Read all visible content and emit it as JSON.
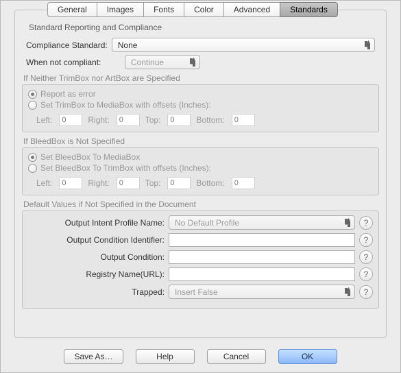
{
  "tabs": {
    "items": [
      "General",
      "Images",
      "Fonts",
      "Color",
      "Advanced",
      "Standards"
    ],
    "active": 5
  },
  "group_title": "Standard Reporting and Compliance",
  "compliance": {
    "label": "Compliance Standard:",
    "value": "None"
  },
  "when_not_compliant": {
    "label": "When not compliant:",
    "value": "Continue"
  },
  "trimbox": {
    "title": "If Neither TrimBox nor ArtBox are Specified",
    "opt1": "Report as error",
    "opt2": "Set TrimBox to MediaBox with offsets (Inches):",
    "selected": 0,
    "offsets": {
      "left_label": "Left:",
      "left": "0",
      "right_label": "Right:",
      "right": "0",
      "top_label": "Top:",
      "top": "0",
      "bottom_label": "Bottom:",
      "bottom": "0"
    }
  },
  "bleedbox": {
    "title": "If BleedBox is Not Specified",
    "opt1": "Set BleedBox To MediaBox",
    "opt2": "Set BleedBox To TrimBox with offsets (Inches):",
    "selected": 0,
    "offsets": {
      "left_label": "Left:",
      "left": "0",
      "right_label": "Right:",
      "right": "0",
      "top_label": "Top:",
      "top": "0",
      "bottom_label": "Bottom:",
      "bottom": "0"
    }
  },
  "defaults": {
    "title": "Default Values if Not Specified in the Document",
    "profile_label": "Output Intent Profile Name:",
    "profile_value": "No Default Profile",
    "cond_id_label": "Output Condition Identifier:",
    "cond_id_value": "",
    "cond_label": "Output Condition:",
    "cond_value": "",
    "registry_label": "Registry Name(URL):",
    "registry_value": "",
    "trapped_label": "Trapped:",
    "trapped_value": "Insert False"
  },
  "buttons": {
    "save_as": "Save As…",
    "help": "Help",
    "cancel": "Cancel",
    "ok": "OK"
  },
  "help_glyph": "?"
}
